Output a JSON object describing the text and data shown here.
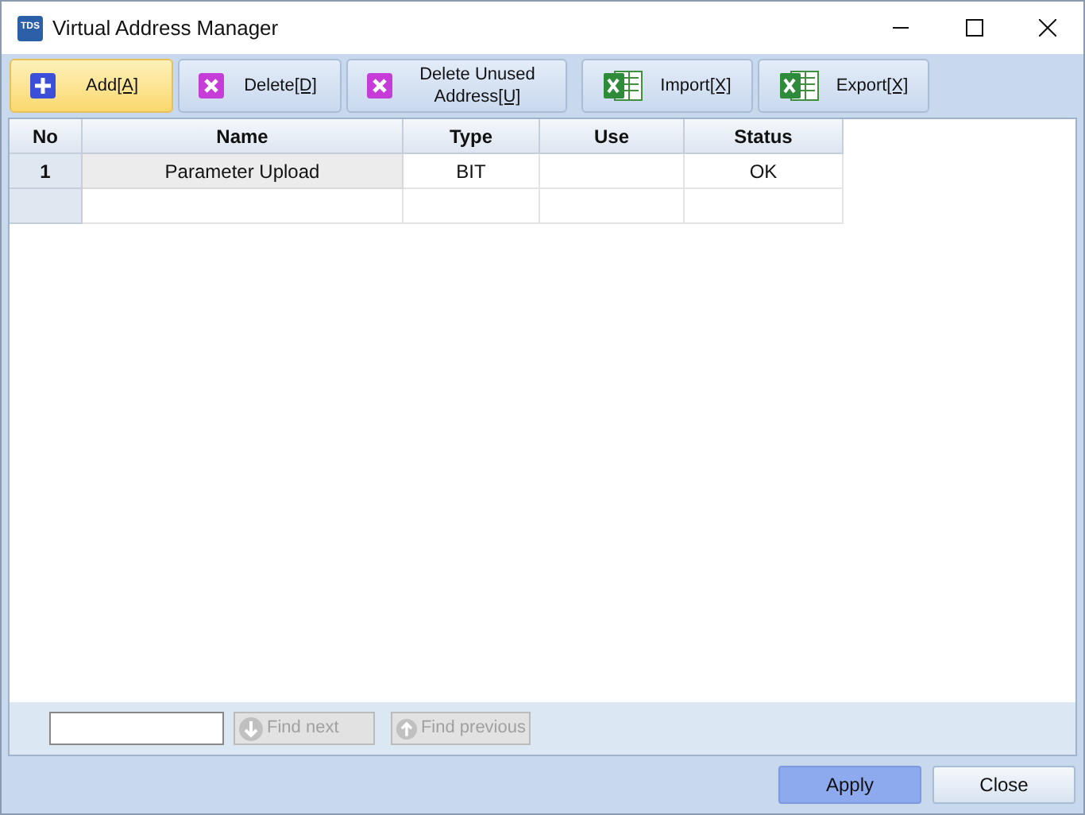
{
  "window": {
    "title": "Virtual Address Manager",
    "app_icon": "TDS"
  },
  "toolbar": [
    {
      "label": "Add",
      "shortcut": "[A]",
      "kind": "add",
      "selected": true
    },
    {
      "label": "Delete",
      "shortcut": "[D]",
      "kind": "delete",
      "selected": false
    },
    {
      "label": "Delete Unused Address",
      "shortcut": "[U]",
      "kind": "delete",
      "selected": false
    },
    {
      "label": "Import",
      "shortcut": "[X]",
      "kind": "excel",
      "selected": false
    },
    {
      "label": "Export",
      "shortcut": "[X]",
      "kind": "excel",
      "selected": false
    }
  ],
  "table": {
    "columns": [
      "No",
      "Name",
      "Type",
      "Use",
      "Status"
    ],
    "rows": [
      [
        "1",
        "Parameter Upload",
        "BIT",
        "",
        "OK"
      ],
      [
        "",
        "",
        "",
        "",
        ""
      ]
    ]
  },
  "find": {
    "next": "Find next",
    "previous": "Find previous",
    "disabled": true
  },
  "buttons": [
    {
      "label": "Apply",
      "selected": true
    },
    {
      "label": "Close",
      "selected": false
    }
  ]
}
